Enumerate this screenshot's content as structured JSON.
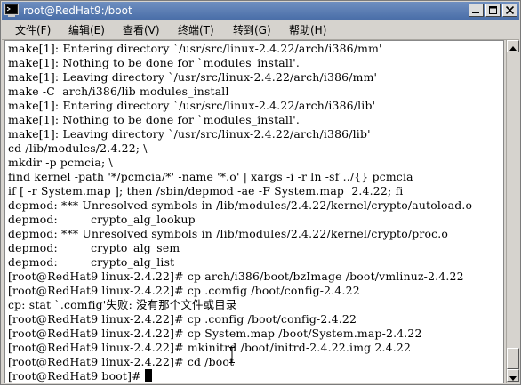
{
  "window": {
    "title": "root@RedHat9:/boot"
  },
  "menu": [
    {
      "label": "文件(F)",
      "key": "F"
    },
    {
      "label": "编辑(E)",
      "key": "E"
    },
    {
      "label": "查看(V)",
      "key": "V"
    },
    {
      "label": "终端(T)",
      "key": "T"
    },
    {
      "label": "转到(G)",
      "key": "G"
    },
    {
      "label": "帮助(H)",
      "key": "H"
    }
  ],
  "terminal": {
    "lines": [
      "make[1]: Entering directory `/usr/src/linux-2.4.22/arch/i386/mm'",
      "make[1]: Nothing to be done for `modules_install'.",
      "make[1]: Leaving directory `/usr/src/linux-2.4.22/arch/i386/mm'",
      "make -C  arch/i386/lib modules_install",
      "make[1]: Entering directory `/usr/src/linux-2.4.22/arch/i386/lib'",
      "make[1]: Nothing to be done for `modules_install'.",
      "make[1]: Leaving directory `/usr/src/linux-2.4.22/arch/i386/lib'",
      "cd /lib/modules/2.4.22; \\",
      "mkdir -p pcmcia; \\",
      "find kernel -path '*/pcmcia/*' -name '*.o' | xargs -i -r ln -sf ../{} pcmcia",
      "if [ -r System.map ]; then /sbin/depmod -ae -F System.map  2.4.22; fi",
      "depmod: *** Unresolved symbols in /lib/modules/2.4.22/kernel/crypto/autoload.o",
      "depmod:         crypto_alg_lookup",
      "depmod: *** Unresolved symbols in /lib/modules/2.4.22/kernel/crypto/proc.o",
      "depmod:         crypto_alg_sem",
      "depmod:         crypto_alg_list",
      "[root@RedHat9 linux-2.4.22]# cp arch/i386/boot/bzImage /boot/vmlinuz-2.4.22",
      "[root@RedHat9 linux-2.4.22]# cp .comfig /boot/config-2.4.22",
      "cp: stat `.comfig'失败: 没有那个文件或目录",
      "[root@RedHat9 linux-2.4.22]# cp .config /boot/config-2.4.22",
      "[root@RedHat9 linux-2.4.22]# cp System.map /boot/System.map-2.4.22",
      "[root@RedHat9 linux-2.4.22]# mkinitrd /boot/initrd-2.4.22.img 2.4.22",
      "[root@RedHat9 linux-2.4.22]# cd /boot"
    ],
    "prompt": "[root@RedHat9 boot]# "
  },
  "icons": [
    "terminal-icon",
    "minimize-icon",
    "maximize-icon",
    "close-icon",
    "scroll-up-icon",
    "scroll-down-icon"
  ]
}
